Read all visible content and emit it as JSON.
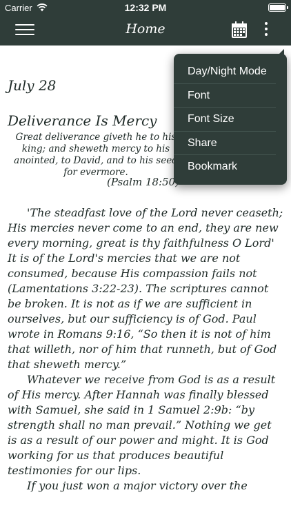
{
  "status_bar": {
    "carrier": "Carrier",
    "time": "12:32 PM"
  },
  "nav": {
    "title": "Home",
    "menu_icon": "hamburger-menu-icon",
    "calendar_icon": "calendar-icon",
    "more_icon": "more-vertical-icon"
  },
  "devotion": {
    "date": "July 28",
    "title": "Deliverance Is Mercy",
    "verse": "Great deliverance giveth he to his king; and sheweth mercy to his anointed, to David, and to his seed for evermore.",
    "reference": "(Psalm 18:50)",
    "paragraphs": [
      "'The steadfast love of the Lord never ceaseth; His mercies never come to an end, they are new every morning, great is thy faithfulness O Lord' It is of the Lord's mercies that we are not consumed, because His compassion fails not (Lamentations 3:22-23). The scriptures cannot be broken. It is not as if we are sufficient in ourselves, but our sufficiency is of God. Paul wrote in Romans 9:16, “So then it is not of him that willeth, nor of him that runneth, but of God that sheweth mercy.”",
      "Whatever we receive from God is as a result of His mercy. After Hannah was finally blessed with Samuel, she said in 1 Samuel 2:9b:  “by strength shall no man prevail.” Nothing we get is as a result of our power and might. It is God working for us that produces beautiful testimonies for our lips.",
      "If you just won a major victory over the"
    ]
  },
  "menu": {
    "items": [
      "Day/Night Mode",
      "Font",
      "Font Size",
      "Share",
      "Bookmark"
    ]
  },
  "colors": {
    "bar": "#2f3d39",
    "text": "#1e2a27"
  }
}
